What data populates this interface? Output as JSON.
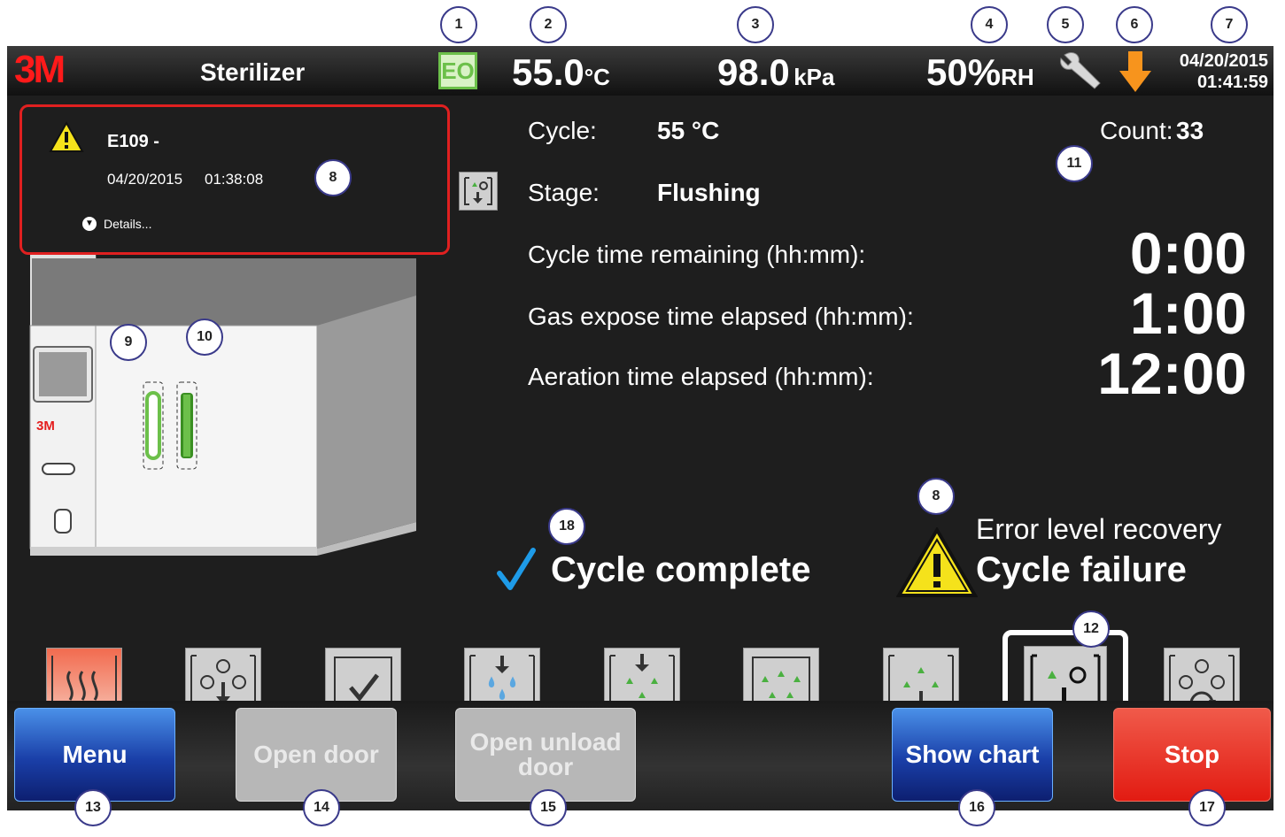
{
  "header": {
    "logo": "3M",
    "title": "Sterilizer",
    "gas_badge": "EO",
    "temperature_value": "55.0",
    "temperature_unit": "°C",
    "pressure_value": "98.0",
    "pressure_unit": "kPa",
    "humidity_value": "50%",
    "humidity_unit": "RH",
    "date": "04/20/2015",
    "time": "01:41:59",
    "service_icon": "wrench-icon",
    "status_icon": "orange-down-arrow-icon",
    "status_color": "#f7941d"
  },
  "alarm": {
    "code": "E109 -",
    "date": "04/20/2015",
    "time": "01:38:08",
    "details_label": "Details...",
    "border_color": "#e02020"
  },
  "machine": {
    "logo": "3M"
  },
  "cycle_info": {
    "cycle_label": "Cycle:",
    "cycle_value": "55 °C",
    "stage_label": "Stage:",
    "stage_value": "Flushing",
    "count_label": "Count:",
    "count_value": "33",
    "remaining_label": "Cycle time remaining (hh:mm):",
    "remaining_value": "0:00",
    "gas_label": "Gas expose time elapsed (hh:mm):",
    "gas_value": "1:00",
    "aeration_label": "Aeration time elapsed (hh:mm):",
    "aeration_value": "12:00"
  },
  "status": {
    "complete_text": "Cycle complete",
    "error_level": "Error level recovery",
    "failure_text": "Cycle failure",
    "check_color": "#1e9be8",
    "warning_color": "#f5e21b"
  },
  "stages": [
    "heat-icon",
    "vacuum-icon",
    "leak-test-check-icon",
    "humidify-icon",
    "gas-inject-icon",
    "gas-expose-icon",
    "gas-remove-icon",
    "flushing-icon",
    "aeration-icon"
  ],
  "buttons": {
    "menu": "Menu",
    "open_door": "Open door",
    "open_unload_door": "Open unload door",
    "show_chart": "Show chart",
    "stop": "Stop"
  },
  "callouts": [
    "1",
    "2",
    "3",
    "4",
    "5",
    "6",
    "7",
    "8",
    "9",
    "10",
    "11",
    "8",
    "18",
    "12",
    "13",
    "14",
    "15",
    "16",
    "17"
  ]
}
